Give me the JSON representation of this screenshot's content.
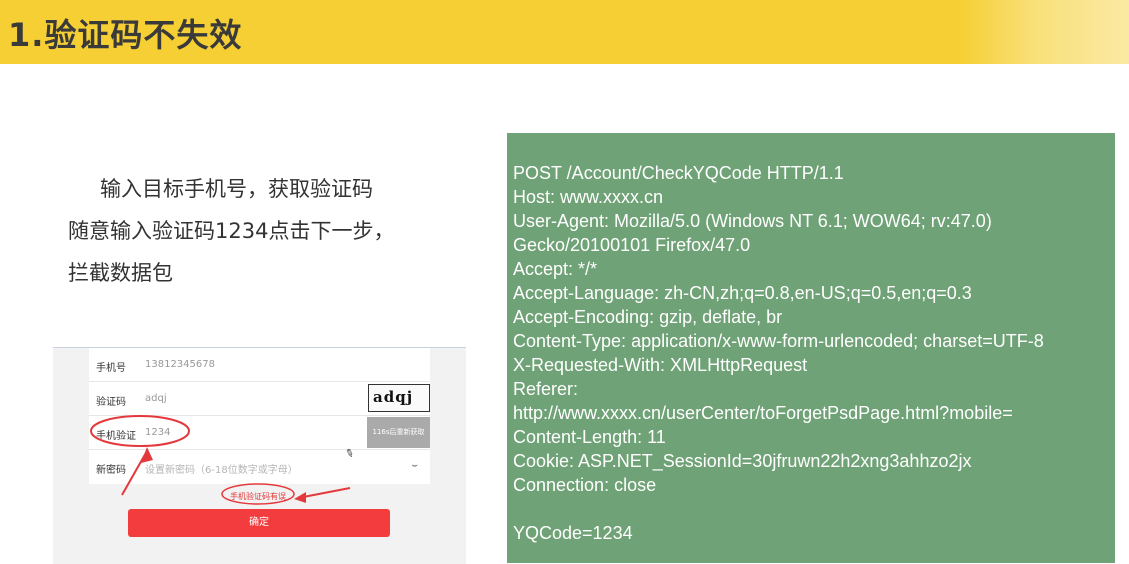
{
  "title": "1.验证码不失效",
  "description": {
    "line1": "输入目标手机号，获取验证码",
    "line2": "随意输入验证码1234点击下一步，",
    "line3": "拦截数据包"
  },
  "form": {
    "phone_label": "手机号",
    "phone_value": "13812345678",
    "captcha_label": "验证码",
    "captcha_value": "adqj",
    "captcha_image_text": "adqj",
    "sms_label": "手机验证",
    "sms_value": "1234",
    "countdown_label": "116s后重新获取",
    "password_label": "新密码",
    "password_placeholder": "设置新密码（6-18位数字或字母）",
    "error_text": "手机验证码有误",
    "confirm_label": "确定"
  },
  "http_request": {
    "lines": [
      "POST /Account/CheckYQCode HTTP/1.1",
      "Host: www.xxxx.cn",
      "User-Agent: Mozilla/5.0 (Windows NT 6.1; WOW64; rv:47.0)",
      "Gecko/20100101 Firefox/47.0",
      "Accept: */*",
      "Accept-Language: zh-CN,zh;q=0.8,en-US;q=0.5,en;q=0.3",
      "Accept-Encoding: gzip, deflate, br",
      "Content-Type: application/x-www-form-urlencoded; charset=UTF-8",
      "X-Requested-With: XMLHttpRequest",
      "Referer:",
      "http://www.xxxx.cn/userCenter/toForgetPsdPage.html?mobile=",
      "Content-Length: 11",
      "Cookie: ASP.NET_SessionId=30jfruwn22h2xng3ahhzo2jx",
      "Connection: close",
      "",
      "YQCode=1234"
    ]
  },
  "colors": {
    "title_bar": "#f5cf33",
    "http_panel": "#6fa276",
    "confirm_button": "#f23c3e",
    "annotation": "#e4393c"
  }
}
